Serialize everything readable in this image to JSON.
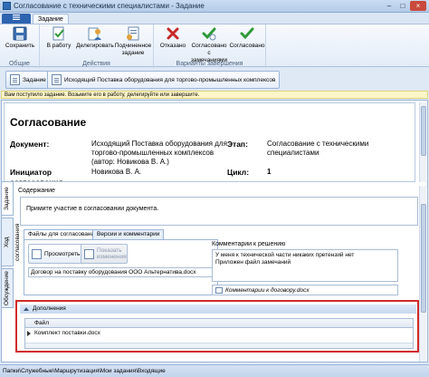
{
  "window": {
    "title": "Согласование с техническими специалистами - Задание",
    "controls": [
      "–",
      "□",
      "×"
    ]
  },
  "ribbon": {
    "file_tab": "",
    "tabs": [
      "Задание"
    ],
    "groups": [
      {
        "label": "Общие",
        "buttons": [
          "Сохранить"
        ]
      },
      {
        "label": "Действия",
        "buttons": [
          "В работу",
          "Делегировать",
          "Подчиненное задание"
        ]
      },
      {
        "label": "Варианты завершения",
        "buttons": [
          "Отказано",
          "Согласовано с замечаниями",
          "Согласовано"
        ]
      }
    ]
  },
  "doc_tabs": [
    {
      "label": "Задание",
      "active": true
    },
    {
      "label": "Исходящий Поставка оборудования для торгово-промышленных комплексов",
      "active": false
    }
  ],
  "info_bar": "Вам поступило задание. Возьмите его в работу, делегируйте или завершите.",
  "header": {
    "title": "Согласование",
    "document_label": "Документ:",
    "document_value": "Исходящий Поставка оборудования для торгово-промышленных комплексов (автор: Новикова В. А.)",
    "stage_label": "Этап:",
    "stage_value": "Согласование с техническими специалистами",
    "initiator_label": "Инициатор согласования",
    "initiator_value": "Новикова В. А.",
    "cycle_label": "Цикл:",
    "cycle_value": "1"
  },
  "side_tabs": [
    "Задание",
    "Ход согласования",
    "Обсуждение"
  ],
  "content": {
    "label": "Содержание",
    "text": "Примите участие в согласовании документа."
  },
  "sub_tabs": [
    "Файлы для согласования",
    "Версии и комментарии"
  ],
  "files": {
    "view_button": "Просмотреть",
    "show_changes_button": "Показать изменения",
    "items": [
      "Договор на поставку оборудования ООО Альтернатива.docx"
    ]
  },
  "comments": {
    "label": "Комментарии к решению",
    "lines": [
      "У меня к технической части никаких претензий нет",
      "Приложен файл замечаний"
    ],
    "attachment": "Комментарии к договору.docx"
  },
  "additions": {
    "title": "Дополнения",
    "column": "Файл",
    "rows": [
      "Комплект поставки.docx"
    ]
  },
  "status_bar": "Папки\\Служебные\\Маршрутизация\\Мои задания\\Входящие",
  "colors": {
    "highlight_border": "#d12b2b",
    "info_bar": "#fdf6c8",
    "reject_icon": "#c62828",
    "approve_icon": "#2e9a3a"
  }
}
